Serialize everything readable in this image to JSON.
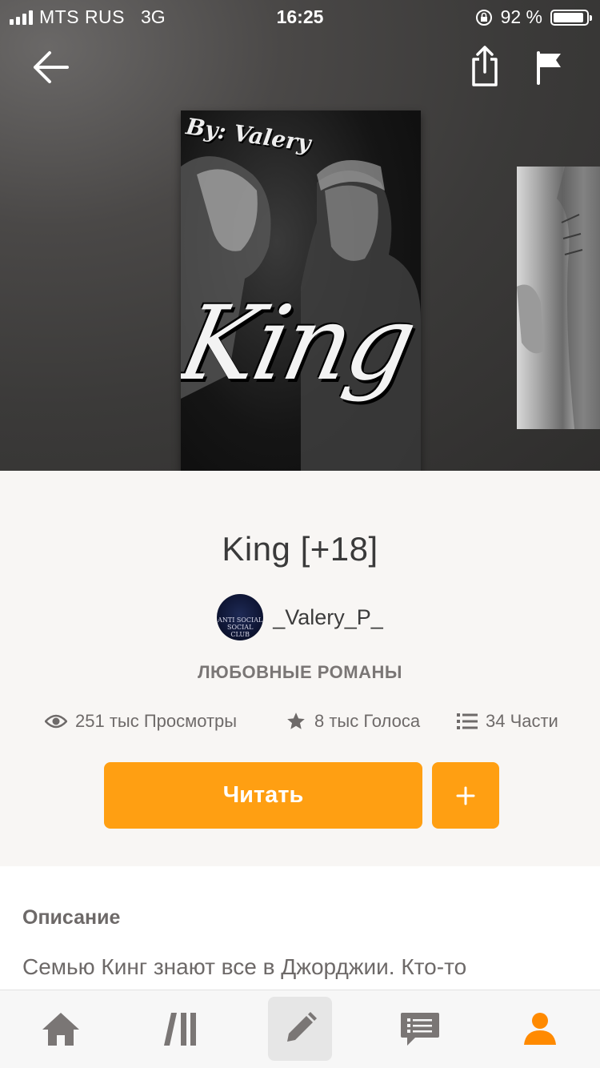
{
  "status_bar": {
    "carrier": "MTS RUS",
    "network": "3G",
    "time": "16:25",
    "battery_percent": "92 %",
    "battery_level": 0.92,
    "signal_bars": 4
  },
  "nav": {
    "back_icon": "arrow-left-icon",
    "share_icon": "share-icon",
    "report_icon": "flag-icon"
  },
  "cover": {
    "byline": "By: Valery",
    "title_art": "King"
  },
  "story": {
    "title": "King [+18]",
    "author": "_Valery_P_",
    "avatar_text": "ANTI SOCIAL SOCIAL CLUB",
    "genre": "ЛЮБОВНЫЕ РОМАНЫ",
    "stats": {
      "views": "251 тыс Просмотры",
      "votes": "8 тыс Голоса",
      "parts": "34 Части"
    }
  },
  "actions": {
    "read_label": "Читать",
    "add_label": "+"
  },
  "description": {
    "heading": "Описание",
    "text": "Семью Кинг знают все в Джорджии. Кто-то"
  },
  "tabbar": {
    "items": [
      {
        "name": "home",
        "icon": "home-icon",
        "active": false
      },
      {
        "name": "library",
        "icon": "library-icon",
        "active": false
      },
      {
        "name": "write",
        "icon": "pencil-icon",
        "active": false
      },
      {
        "name": "messages",
        "icon": "chat-icon",
        "active": false
      },
      {
        "name": "profile",
        "icon": "user-icon",
        "active": true
      }
    ]
  },
  "colors": {
    "accent": "#ff9f12",
    "active_tab": "#ff8a00",
    "inactive_tab": "#7a7675"
  }
}
